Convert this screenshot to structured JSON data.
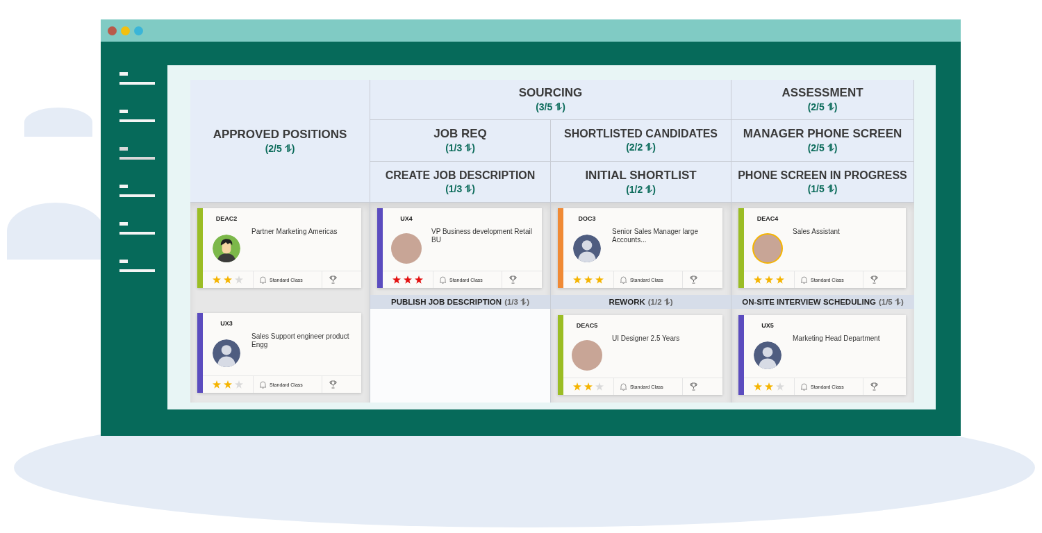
{
  "window": {
    "sidebar": {
      "items": [
        {
          "selected": false
        },
        {
          "selected": false
        },
        {
          "selected": true
        },
        {
          "selected": false
        },
        {
          "selected": false
        },
        {
          "selected": false
        }
      ]
    }
  },
  "board": {
    "stages": [
      {
        "title": "APPROVED POSITIONS",
        "count": "(2/5 ⥮)",
        "sections": [
          {
            "cards": [
              {
                "code": "DEAC2",
                "title": "Partner Marketing Americas",
                "avatar": {
                  "kind": "cartoon",
                  "highlighted": false
                },
                "color": "#9bbd24",
                "rating": {
                  "stars": 2,
                  "color": "#f5b400"
                },
                "tag": "Standard Class"
              },
              {
                "code": "UX3",
                "title": "Sales Support engineer product Engg",
                "avatar": {
                  "kind": "silhouette",
                  "highlighted": false
                },
                "color": "#5b4cbf",
                "rating": {
                  "stars": 2,
                  "color": "#f5b400"
                },
                "tag": "Standard Class"
              }
            ]
          }
        ]
      },
      {
        "title": "SOURCING",
        "count": "(3/5 ⥮)",
        "children": [
          {
            "title": "JOB REQ",
            "count": "(1/3 ⥮)",
            "children": [
              {
                "title": "CREATE JOB DESCRIPTION",
                "count": "(1/3 ⥮)",
                "sections": [
                  {
                    "cards": [
                      {
                        "code": "UX4",
                        "title": "VP Business development Retail BU",
                        "avatar": {
                          "kind": "photo",
                          "highlighted": false
                        },
                        "color": "#5b4cbf",
                        "rating": {
                          "stars": 3,
                          "color": "#e31010"
                        },
                        "tag": "Standard Class"
                      }
                    ]
                  },
                  {
                    "title": "PUBLISH JOB DESCRIPTION",
                    "count": "(1/3 ⥮)"
                  }
                ]
              }
            ]
          },
          {
            "title": "SHORTLISTED CANDIDATES",
            "count": "(2/2 ⥮)",
            "children": [
              {
                "title": "INITIAL SHORTLIST",
                "count": "(1/2 ⥮)",
                "sections": [
                  {
                    "cards": [
                      {
                        "code": "DOC3",
                        "title": "Senior Sales Manager large Accounts...",
                        "avatar": {
                          "kind": "silhouette",
                          "highlighted": false
                        },
                        "color": "#f08a35",
                        "rating": {
                          "stars": 3,
                          "color": "#f5b400"
                        },
                        "tag": "Standard Class"
                      }
                    ]
                  },
                  {
                    "title": "REWORK",
                    "count": "(1/2 ⥮)",
                    "cards": [
                      {
                        "code": "DEAC5",
                        "title": "UI Designer 2.5 Years",
                        "avatar": {
                          "kind": "photo",
                          "highlighted": false
                        },
                        "color": "#9bbd24",
                        "rating": {
                          "stars": 2,
                          "color": "#f5b400"
                        },
                        "tag": "Standard Class"
                      }
                    ]
                  }
                ]
              }
            ]
          }
        ]
      },
      {
        "title": "ASSESSMENT",
        "count": "(2/5 ⥮)",
        "children": [
          {
            "title": "MANAGER PHONE SCREEN",
            "count": "(2/5 ⥮)",
            "children": [
              {
                "title": "PHONE SCREEN IN PROGRESS",
                "count": "(1/5 ⥮)",
                "sections": [
                  {
                    "cards": [
                      {
                        "code": "DEAC4",
                        "title": "Sales Assistant",
                        "avatar": {
                          "kind": "photo",
                          "highlighted": true
                        },
                        "color": "#9bbd24",
                        "rating": {
                          "stars": 3,
                          "color": "#f5b400"
                        },
                        "tag": "Standard Class"
                      }
                    ]
                  },
                  {
                    "title": "ON-SITE INTERVIEW SCHEDULING",
                    "count": "(1/5 ⥮)",
                    "cards": [
                      {
                        "code": "UX5",
                        "title": "Marketing Head Department",
                        "avatar": {
                          "kind": "silhouette",
                          "highlighted": false
                        },
                        "color": "#5b4cbf",
                        "rating": {
                          "stars": 2,
                          "color": "#f5b400"
                        },
                        "tag": "Standard Class"
                      }
                    ]
                  }
                ]
              }
            ]
          }
        ]
      }
    ]
  }
}
